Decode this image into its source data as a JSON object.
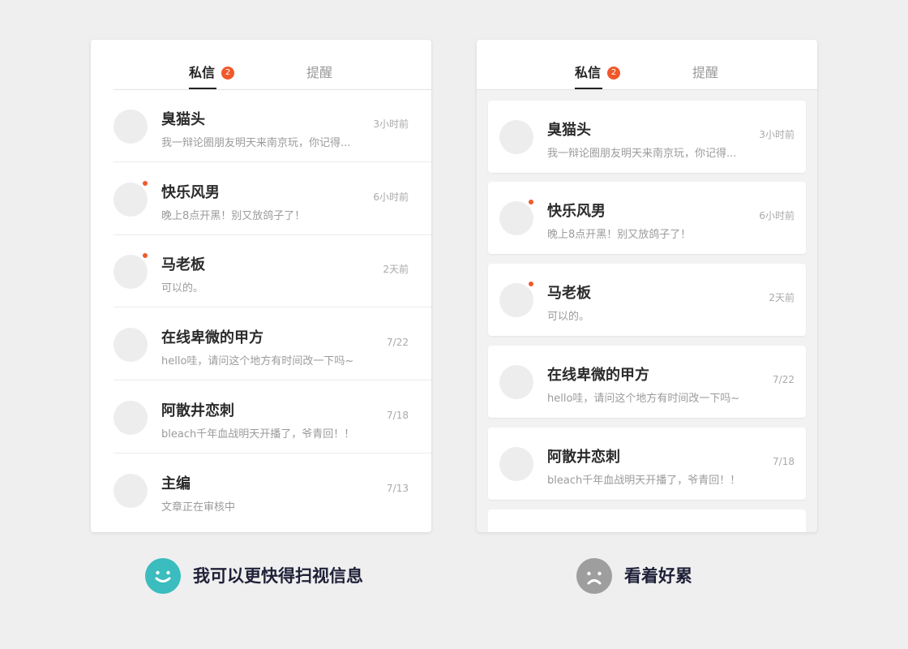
{
  "tabs": {
    "messages_label": "私信",
    "messages_badge": "2",
    "reminders_label": "提醒"
  },
  "left_panel": {
    "conversations": [
      {
        "name": "臭猫头",
        "preview": "我一辩论圈朋友明天来南京玩，你记得...",
        "time": "3小时前",
        "unread": false
      },
      {
        "name": "快乐风男",
        "preview": "晚上8点开黑！别又放鸽子了！",
        "time": "6小时前",
        "unread": true
      },
      {
        "name": "马老板",
        "preview": "可以的。",
        "time": "2天前",
        "unread": true
      },
      {
        "name": "在线卑微的甲方",
        "preview": "hello哇，请问这个地方有时间改一下吗~",
        "time": "7/22",
        "unread": false
      },
      {
        "name": "阿散井恋刺",
        "preview": "bleach千年血战明天开播了，爷青回！！",
        "time": "7/18",
        "unread": false
      },
      {
        "name": "主编",
        "preview": "文章正在审核中",
        "time": "7/13",
        "unread": false
      }
    ]
  },
  "right_panel": {
    "conversations": [
      {
        "name": "臭猫头",
        "preview": "我一辩论圈朋友明天来南京玩，你记得...",
        "time": "3小时前",
        "unread": false
      },
      {
        "name": "快乐风男",
        "preview": "晚上8点开黑！别又放鸽子了！",
        "time": "6小时前",
        "unread": true
      },
      {
        "name": "马老板",
        "preview": "可以的。",
        "time": "2天前",
        "unread": true
      },
      {
        "name": "在线卑微的甲方",
        "preview": "hello哇，请问这个地方有时间改一下吗~",
        "time": "7/22",
        "unread": false
      },
      {
        "name": "阿散井恋刺",
        "preview": "bleach千年血战明天开播了，爷青回！！",
        "time": "7/18",
        "unread": false
      }
    ]
  },
  "captions": {
    "good": {
      "text": "我可以更快得扫视信息",
      "icon": "happy-face-icon",
      "color": "#3bbcbe"
    },
    "bad": {
      "text": "看着好累",
      "icon": "sad-face-icon",
      "color": "#9e9e9e"
    }
  },
  "colors": {
    "accent": "#f0582b",
    "unread_dot": "#ee5a2d",
    "background": "#efefef"
  }
}
